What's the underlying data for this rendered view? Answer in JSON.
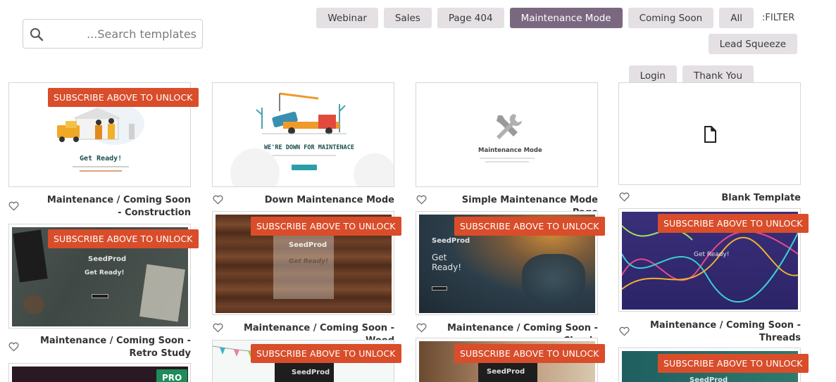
{
  "search": {
    "placeholder": "...Search templates"
  },
  "filter": {
    "label": ":FILTER",
    "row1": [
      "All",
      "Coming Soon",
      "Maintenance Mode",
      "Page 404",
      "Sales",
      "Webinar",
      "Lead Squeeze"
    ],
    "row2": [
      "Thank You",
      "Login"
    ],
    "active": "Maintenance Mode"
  },
  "badge_text": "SUBSCRIBE ABOVE TO UNLOCK",
  "pro_text": "PRO",
  "cards": {
    "construction": {
      "title": "Maintenance / Coming Soon - Construction",
      "heading": "Get Ready!"
    },
    "down": {
      "title": "Down Maintenance Mode",
      "heading": "WE'RE DOWN FOR MAINTENACE"
    },
    "simple": {
      "title": "Simple Maintenance Mode Page",
      "heading": "Maintenance Mode"
    },
    "blank": {
      "title": "Blank Template"
    },
    "retro": {
      "title": "Maintenance / Coming Soon - Retro Study",
      "heading": "Get Ready!",
      "brand": "SeedProd"
    },
    "wood": {
      "title": "Maintenance / Coming Soon - Wood",
      "heading": "Get Ready!",
      "brand": "SeedProd"
    },
    "clouds": {
      "title": "Maintenance / Coming Soon - Clouds",
      "heading": "Get Ready!",
      "brand": "SeedProd"
    },
    "threads": {
      "title": "Maintenance / Coming Soon - Threads",
      "heading": "Get Ready!"
    },
    "row3b": {
      "brand": "SeedProd"
    },
    "row3c": {
      "brand": "SeedProd"
    },
    "row3d": {
      "brand": "SeedProd"
    }
  },
  "colors": {
    "badge": "#d94d2a",
    "active_filter": "#7a6880",
    "filter_bg": "#e4e0e4",
    "pro": "#1e8c5a"
  },
  "icons": {
    "search": "search-icon",
    "heart": "heart-icon",
    "file": "file-icon",
    "tools": "tools-icon"
  }
}
